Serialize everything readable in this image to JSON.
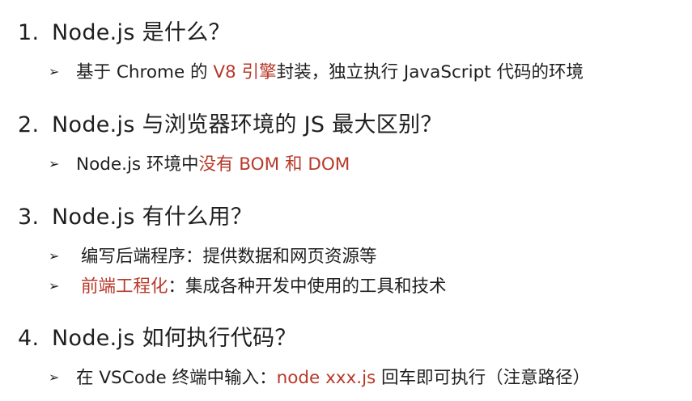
{
  "accent_color": "#b8392a",
  "bullet_glyph": "➢",
  "sections": [
    {
      "number": "1.",
      "question": "Node.js 是什么？",
      "answers": [
        {
          "segments": [
            "基于 Chrome 的 ",
            "V8 引擎",
            "封装，独立执行 JavaScript 代码的环境"
          ]
        }
      ]
    },
    {
      "number": "2.",
      "question": "Node.js 与浏览器环境的 JS 最大区别？",
      "answers": [
        {
          "segments": [
            "Node.js 环境中",
            "没有 BOM 和 DOM"
          ]
        }
      ]
    },
    {
      "number": "3.",
      "question": "Node.js 有什么用？",
      "answers": [
        {
          "segments": [
            "编写后端程序：提供数据和网页资源等"
          ]
        },
        {
          "segments": [
            "前端工程化",
            "：集成各种开发中使用的工具和技术"
          ]
        }
      ]
    },
    {
      "number": "4.",
      "question": "Node.js 如何执行代码？",
      "answers": [
        {
          "segments": [
            "在 VSCode 终端中输入：",
            "node xxx.js",
            " 回车即可执行（注意路径）"
          ]
        }
      ]
    }
  ]
}
